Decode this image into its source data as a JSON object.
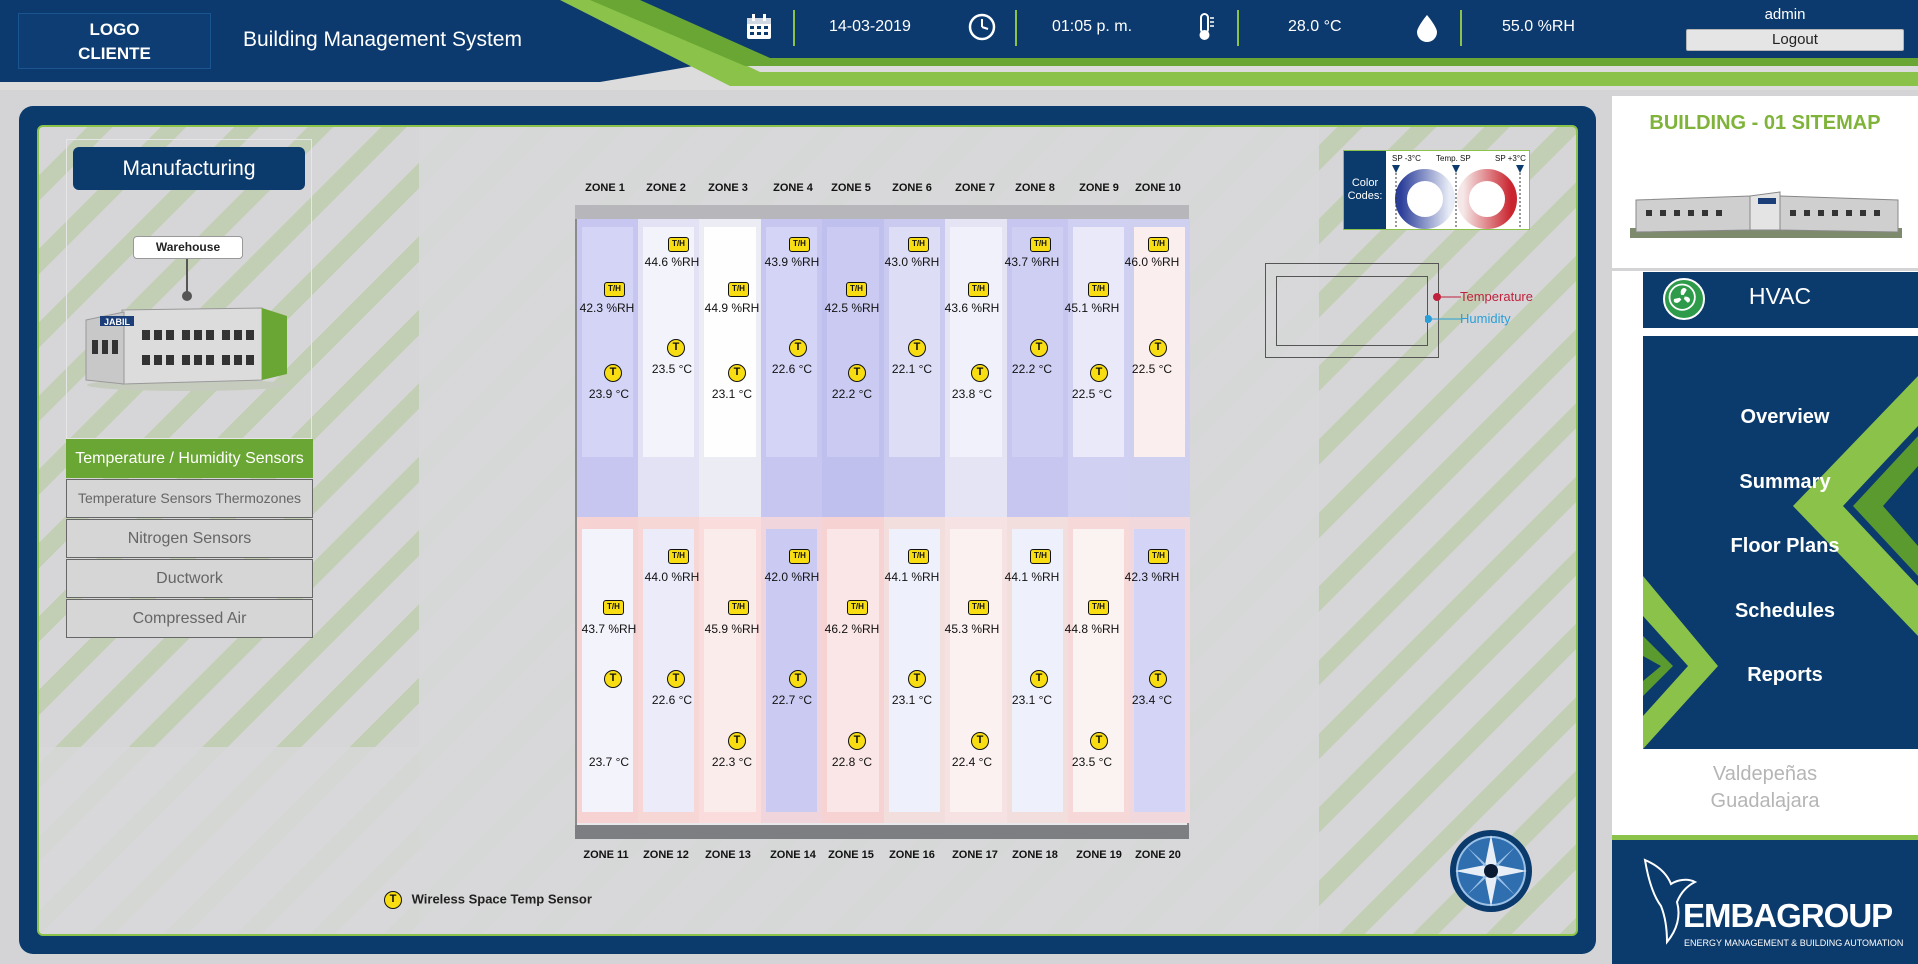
{
  "header": {
    "logo_line1": "LOGO",
    "logo_line2": "CLIENTE",
    "app_title": "Building Management System",
    "date": "14-03-2019",
    "time": "01:05 p. m.",
    "temperature": "28.0 °C",
    "humidity": "55.0 %RH",
    "user": "admin",
    "logout_label": "Logout"
  },
  "left": {
    "area_title": "Manufacturing",
    "building_label": "Warehouse",
    "menu": [
      "Temperature / Humidity Sensors",
      "Temperature Sensors Thermozones",
      "Nitrogen Sensors",
      "Ductwork",
      "Compressed Air"
    ]
  },
  "plan": {
    "top_zones": [
      "ZONE 1",
      "ZONE 2",
      "ZONE 3",
      "ZONE 4",
      "ZONE 5",
      "ZONE 6",
      "ZONE 7",
      "ZONE 8",
      "ZONE 9",
      "ZONE 10"
    ],
    "bottom_zones": [
      "ZONE 11",
      "ZONE 12",
      "ZONE 13",
      "ZONE 14",
      "ZONE 15",
      "ZONE 16",
      "ZONE 17",
      "ZONE 18",
      "ZONE 19",
      "ZONE 20"
    ],
    "top_rh": [
      "42.3 %RH",
      "44.6 %RH",
      "44.9 %RH",
      "43.9 %RH",
      "42.5 %RH",
      "43.0 %RH",
      "43.6 %RH",
      "43.7 %RH",
      "45.1 %RH",
      "46.0 %RH"
    ],
    "top_t": [
      "23.9 °C",
      "23.5 °C",
      "23.1 °C",
      "22.6 °C",
      "22.2 °C",
      "22.1 °C",
      "23.8 °C",
      "22.2 °C",
      "22.5 °C",
      "22.5 °C"
    ],
    "bottom_rh": [
      "43.7 %RH",
      "44.0 %RH",
      "45.9 %RH",
      "42.0 %RH",
      "46.2 %RH",
      "44.1 %RH",
      "45.3 %RH",
      "44.1 %RH",
      "44.8 %RH",
      "42.3 %RH"
    ],
    "bottom_t": [
      "23.7 °C",
      "22.6 °C",
      "22.3 °C",
      "22.7 °C",
      "22.8 °C",
      "23.1 °C",
      "22.4 °C",
      "23.1 °C",
      "23.5 °C",
      "23.4 °C"
    ],
    "sensor_t_glyph": "T",
    "sensor_th_glyph": "T/H"
  },
  "legend": {
    "color_codes_label": "Color Codes:",
    "sp_minus": "SP -3°C",
    "sp": "Temp. SP",
    "sp_plus": "SP +3°C",
    "temperature": "Temperature",
    "humidity": "Humidity",
    "sensor_legend": "Wireless Space Temp Sensor",
    "cold_color": "#3a4fa8",
    "hot_color": "#d0343f"
  },
  "sidebar": {
    "building_title": "BUILDING - 01 SITEMAP",
    "section": "HVAC",
    "nav": [
      "Overview",
      "Summary",
      "Floor Plans",
      "Schedules",
      "Reports"
    ],
    "site_line1": "Valdepeñas",
    "site_line2": "Guadalajara",
    "company": "EMBAGROUP",
    "company_sub": "ENERGY MANAGEMENT & BUILDING AUTOMATION"
  },
  "colors": {
    "navy": "#0b3a6c",
    "green": "#8bc34a",
    "sensor_yellow": "#f7dd12"
  }
}
